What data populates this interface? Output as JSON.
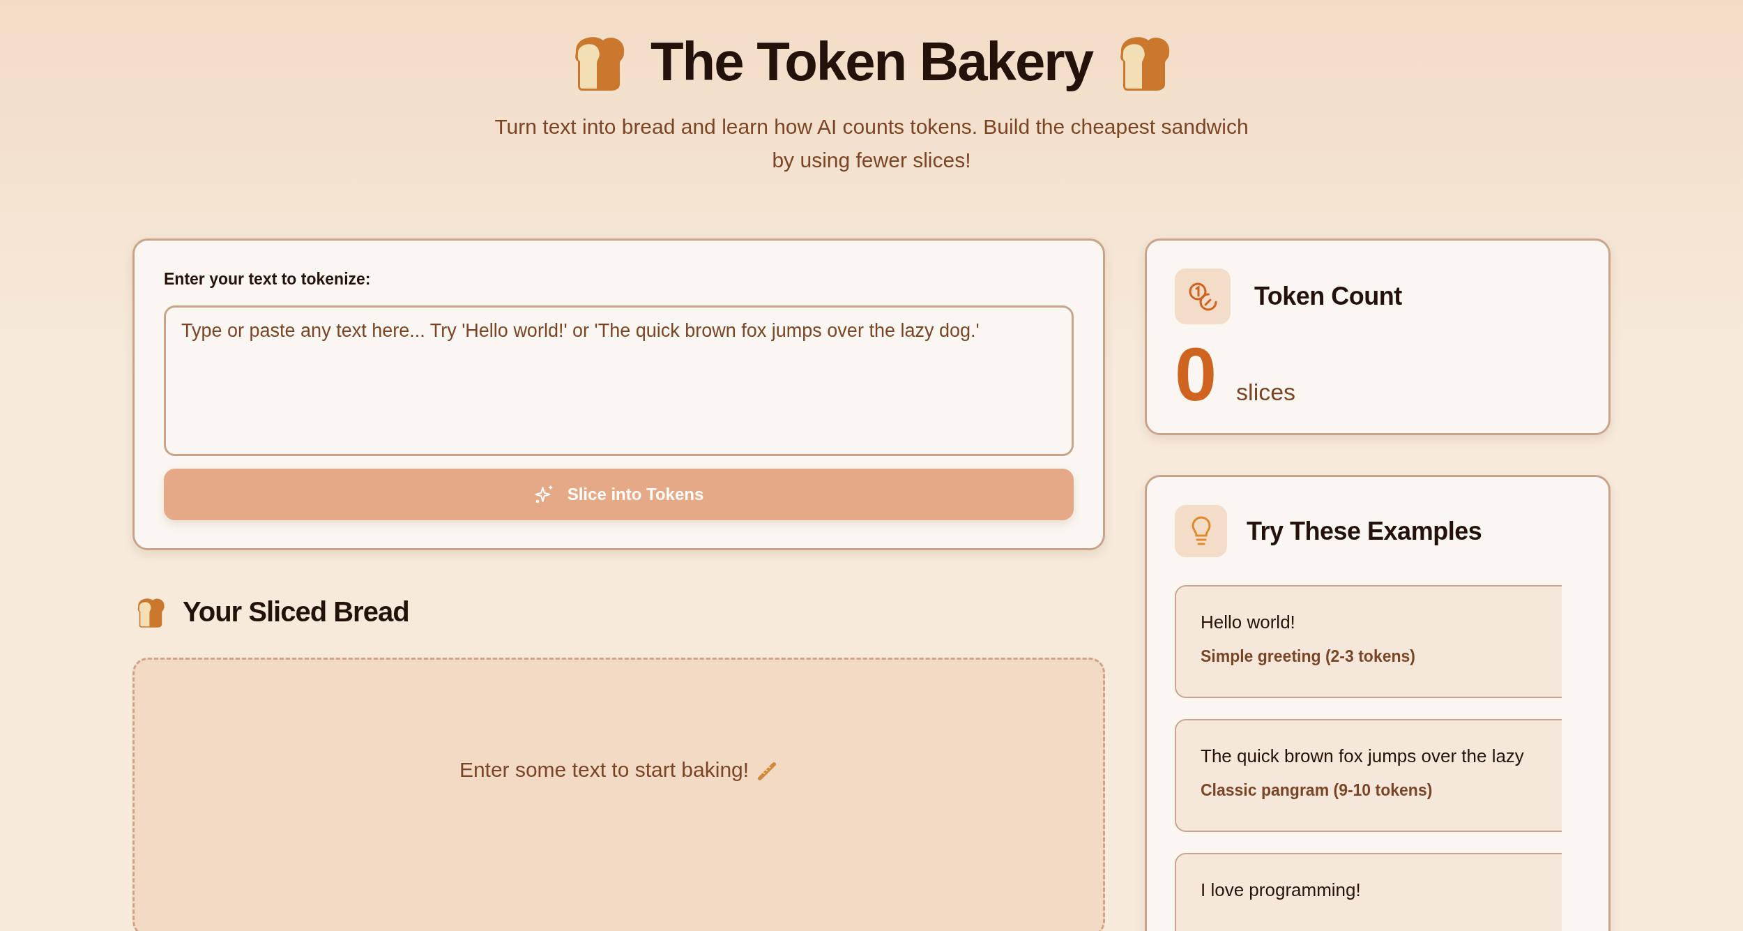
{
  "header": {
    "title": "The Token Bakery",
    "subtitle": "Turn text into bread and learn how AI counts tokens. Build the cheapest sandwich by using fewer slices!"
  },
  "input_card": {
    "label": "Enter your text to tokenize:",
    "placeholder": "Type or paste any text here... Try 'Hello world!' or 'The quick brown fox jumps over the lazy dog.'",
    "button": "Slice into Tokens",
    "button_disabled": true
  },
  "sliced_section": {
    "title": "Your Sliced Bread",
    "empty_message": "Enter some text to start baking!"
  },
  "token_count": {
    "title": "Token Count",
    "value": "0",
    "unit": "slices"
  },
  "examples": {
    "title": "Try These Examples",
    "items": [
      {
        "text": "Hello world!",
        "description": "Simple greeting (2-3 tokens)"
      },
      {
        "text": "The quick brown fox jumps over the lazy",
        "description": "Classic pangram (9-10 tokens)"
      },
      {
        "text": "I love programming!"
      }
    ]
  }
}
